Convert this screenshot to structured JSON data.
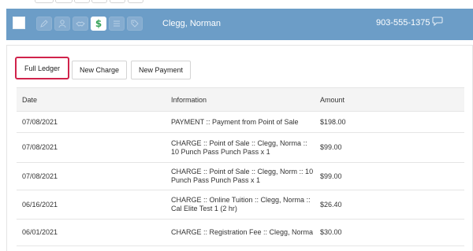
{
  "header": {
    "customer_name": "Clegg, Norman",
    "customer_phone": "903-555-1375",
    "active_tool_glyph": "$",
    "tools": [
      "edit-icon",
      "person-icon",
      "handshake-icon",
      "dollar-icon",
      "list-icon",
      "tag-icon"
    ],
    "background_color": "#6c9dc7"
  },
  "actions": {
    "full_ledger": "Full Ledger",
    "new_charge": "New Charge",
    "new_payment": "New Payment",
    "highlight_color": "#d0234b"
  },
  "table": {
    "headers": {
      "date": "Date",
      "information": "Information",
      "amount": "Amount"
    },
    "rows": [
      {
        "date": "07/08/2021",
        "information": "PAYMENT :: Payment from Point of Sale",
        "amount": "$198.00"
      },
      {
        "date": "07/08/2021",
        "information": "CHARGE :: Point of Sale :: Clegg, Norma :: 10 Punch Pass Punch Pass x 1",
        "amount": "$99.00"
      },
      {
        "date": "07/08/2021",
        "information": "CHARGE :: Point of Sale :: Clegg, Norm :: 10 Punch Pass Punch Pass x 1",
        "amount": "$99.00"
      },
      {
        "date": "06/16/2021",
        "information": "CHARGE :: Online Tuition :: Clegg, Norma :: Cal Elite Test 1 (2 hr)",
        "amount": "$26.40"
      },
      {
        "date": "06/01/2021",
        "information": "CHARGE :: Registration Fee :: Clegg, Norma",
        "amount": "$30.00"
      }
    ]
  }
}
